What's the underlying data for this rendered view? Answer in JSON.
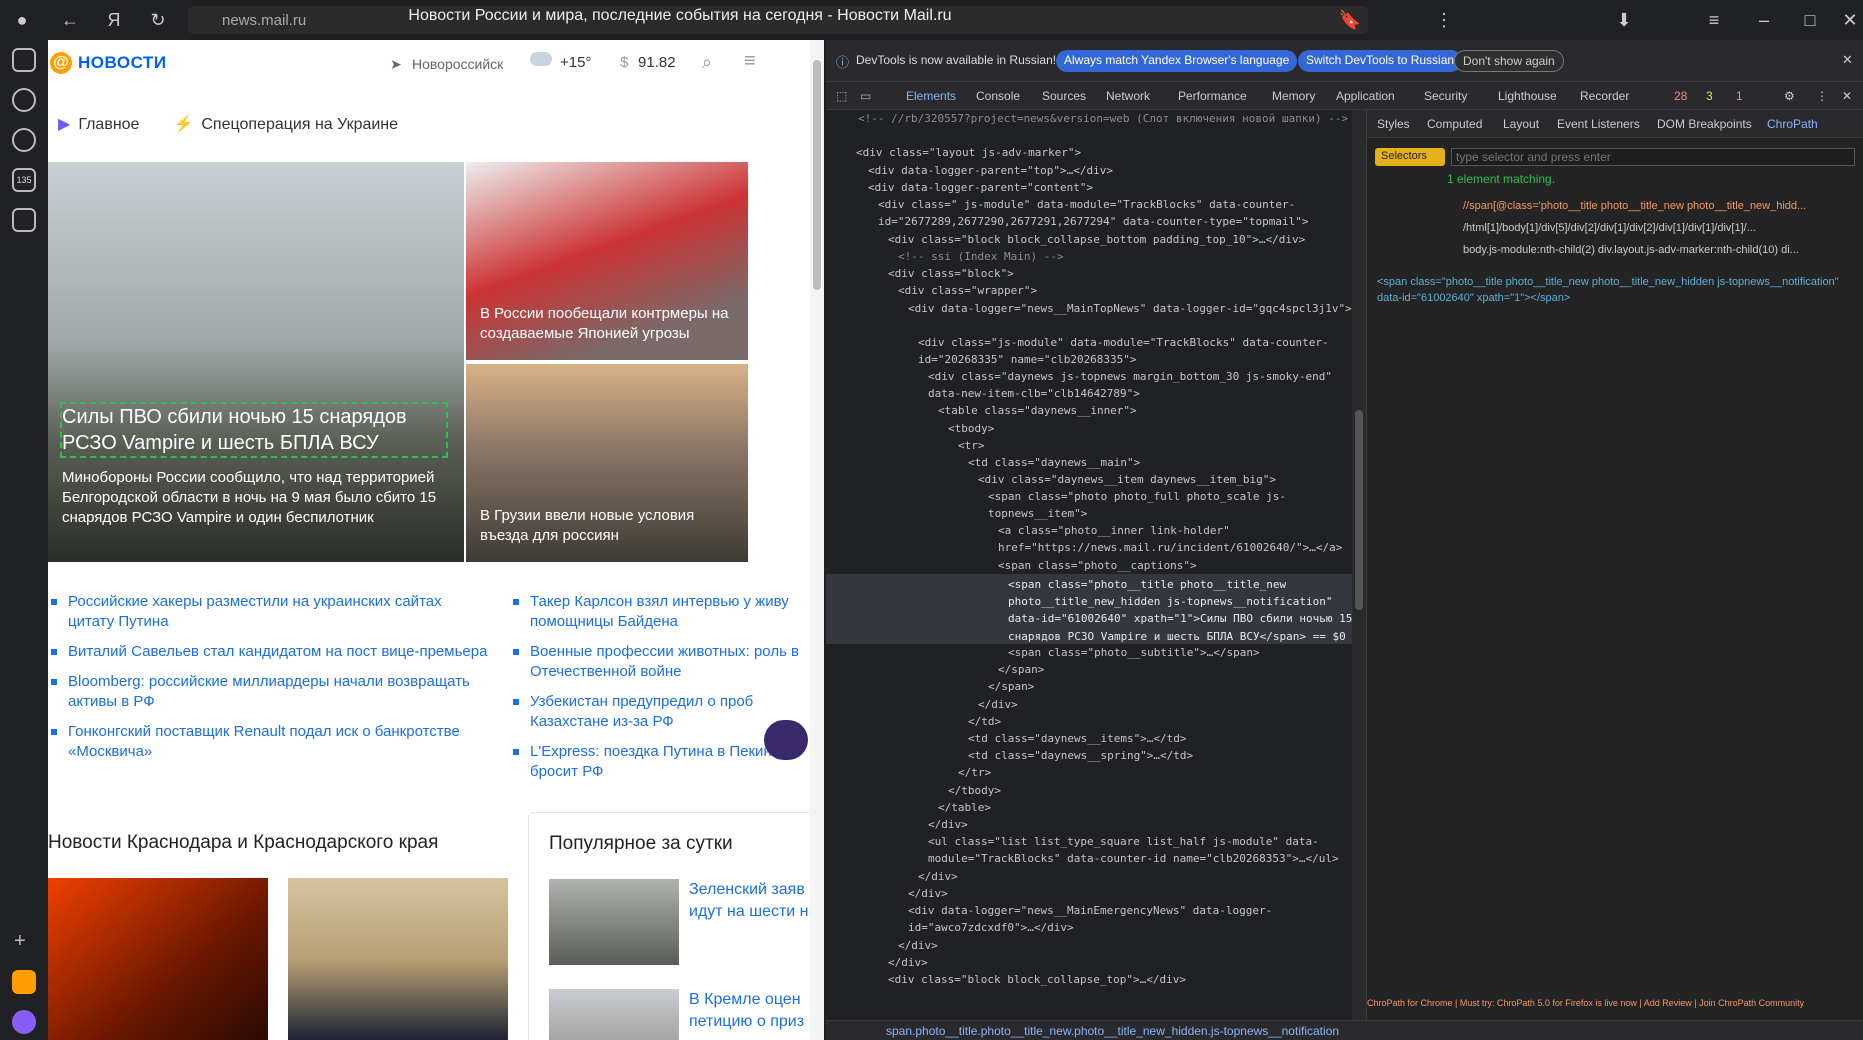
{
  "browser": {
    "url": "news.mail.ru",
    "title": "Новости России и мира, последние события на сегодня - Новости Mail.ru",
    "bookmark_count": "135"
  },
  "news": {
    "logo_text": "НОВОСТИ",
    "city": "Новороссийск",
    "temp": "+15°",
    "currency": "91.82",
    "nav": [
      "Главное",
      "Спецоперация на Украине"
    ],
    "hero": {
      "title": "Силы ПВО сбили ночью 15 снарядов РСЗО Vampire и шесть БПЛА ВСУ",
      "subtitle": "Минобороны России сообщило, что над территорией Белгородской области в ночь на 9 мая было сбито 15 снарядов РСЗО Vampire и один беспилотник"
    },
    "tiles": [
      {
        "caption": "В России пообещали контрмеры на создаваемые Японией угрозы"
      },
      {
        "caption": "В Грузии ввели новые условия въезда для россиян"
      }
    ],
    "links_left": [
      "Российские хакеры разместили на украинских сайтах цитату Путина",
      "Виталий Савельев стал кандидатом на пост вице-премьера",
      "Bloomberg: российские миллиардеры начали возвращать активы в РФ",
      "Гонконгский поставщик Renault подал иск о банкротстве «Москвича»"
    ],
    "links_right": [
      "Такер Карлсон взял интервью у живу помощницы Байдена",
      "Военные профессии животных: роль в Отечественной войне",
      "Узбекистан предупредил о проб Казахстане из-за РФ",
      "L'Express: поездка Путина в Пекин озн бросит РФ"
    ],
    "section_title": "Новости Краснодара и Краснодарского края",
    "popular_title": "Популярное за сутки",
    "popular_items": [
      "Зеленский заяв идут на шести н",
      "В Кремле оцен петицию о приз"
    ]
  },
  "devtools": {
    "info_text": "DevTools is now available in Russian!",
    "btn_match": "Always match Yandex Browser's language",
    "btn_switch": "Switch DevTools to Russian",
    "btn_dont": "Don't show again",
    "tabs": [
      "Elements",
      "Console",
      "Sources",
      "Network",
      "Performance",
      "Memory",
      "Application",
      "Security",
      "Lighthouse",
      "Recorder"
    ],
    "errors": "28",
    "warnings": "3",
    "issues": "1",
    "right_tabs": [
      "Styles",
      "Computed",
      "Layout",
      "Event Listeners",
      "DOM Breakpoints",
      "ChroPath"
    ],
    "selector_label": "Selectors",
    "selector_placeholder": "type selector and press enter",
    "matching_text": "1 element matching.",
    "rel_xpath": "//span[@class='photo__title photo__title_new photo__title_new_hidd...",
    "abs_xpath": "/html[1]/body[1]/div[5]/div[2]/div[1]/div[2]/div[1]/div[1]/div[1]/...",
    "css_sel": "body.js-module:nth-child(2) div.layout.js-adv-marker:nth-child(10) di...",
    "preview_html": "<span class=\"photo__title photo__title_new photo__title_new_hidden js-topnews__notification\" data-id=\"61002640\" xpath=\"1\"></span>",
    "status_path": "span.photo__title.photo__title_new.photo__title_new_hidden.js-topnews__notification",
    "footer_text": "ChroPath for Chrome | Must try: ChroPath 5.0 for Firefox is live now | Add Review | Join ChroPath Community",
    "dom_lines": [
      "<!-- //rb/320557?project=news&version=web (Слот включения новой шапки) -->",
      "<div class=\"layout js-adv-marker\">",
      "<div data-logger-parent=\"top\">…</div>",
      "<div data-logger-parent=\"content\">",
      "<div class=\" js-module\" data-module=\"TrackBlocks\" data-counter-id=\"2677289,2677290,2677291,2677294\" data-counter-type=\"topmail\">",
      "<div class=\"block block_collapse_bottom padding_top_10\">…</div>",
      "<!-- ssi (Index Main) -->",
      "<div class=\"block\">",
      "<div class=\"wrapper\">",
      "<div data-logger=\"news__MainTopNews\" data-logger-id=\"gqc4spcl3j1v\">",
      "<div class=\"js-module\" data-module=\"TrackBlocks\" data-counter-id=\"20268335\" name=\"clb20268335\">",
      "<div class=\"daynews js-topnews margin_bottom_30 js-smoky-end\" data-new-item-clb=\"clb14642789\">",
      "<table class=\"daynews__inner\">",
      "<tbody>",
      "<tr>",
      "<td class=\"daynews__main\">",
      "<div class=\"daynews__item daynews__item_big\">",
      "<span class=\"photo photo_full photo_scale js-topnews__item\">",
      "<a class=\"photo__inner link-holder\" href=\"https://news.mail.ru/incident/61002640/\">…</a>",
      "<span class=\"photo__captions\">",
      "<span class=\"photo__title photo__title_new photo__title_new_hidden js-topnews__notification\" data-id=\"61002640\" xpath=\"1\">Силы ПВО сбили ночью 15 снарядов РСЗО Vampire и шесть БПЛА ВСУ</span> == $0",
      "<span class=\"photo__subtitle\">…</span>",
      "</span>",
      "</span>",
      "</div>",
      "</td>",
      "<td class=\"daynews__items\">…</td>",
      "<td class=\"daynews__spring\">…</td>",
      "</tr>",
      "</tbody>",
      "</table>",
      "</div>",
      "<ul class=\"list list_type_square list_half js-module\" data-module=\"TrackBlocks\" data-counter-id name=\"clb20268353\">…</ul>",
      "</div>",
      "</div>",
      "<div data-logger=\"news__MainEmergencyNews\" data-logger-id=\"awco7zdcxdf0\">…</div>",
      "</div>",
      "</div>",
      "<div class=\"block block_collapse_top\">…</div>"
    ]
  }
}
